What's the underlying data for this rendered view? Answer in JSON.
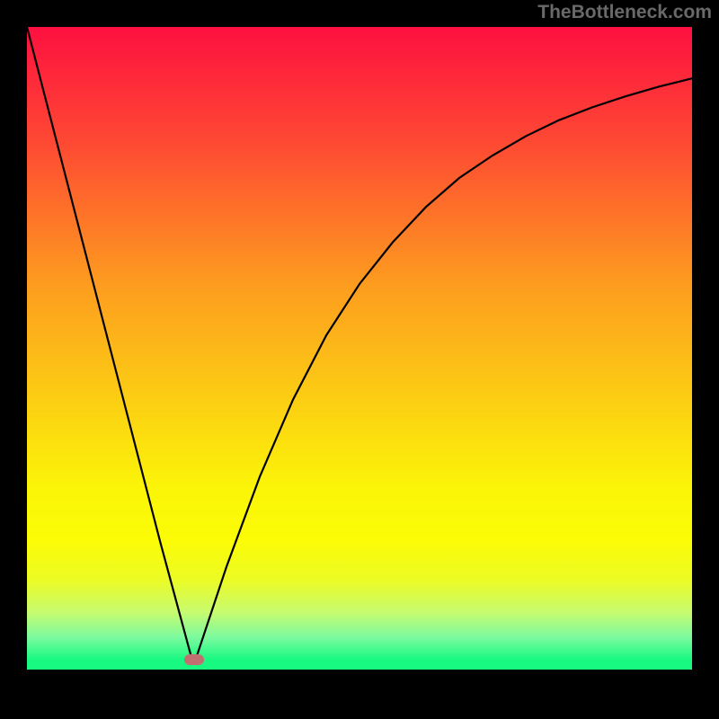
{
  "attribution": "TheBottleneck.com",
  "chart_data": {
    "type": "line",
    "title": "",
    "xlabel": "",
    "ylabel": "",
    "x_range": [
      0,
      1
    ],
    "y_range": [
      0,
      1
    ],
    "series": [
      {
        "name": "bottleneck-curve",
        "x": [
          0.0,
          0.05,
          0.1,
          0.15,
          0.2,
          0.247,
          0.255,
          0.3,
          0.35,
          0.4,
          0.45,
          0.5,
          0.55,
          0.6,
          0.65,
          0.7,
          0.75,
          0.8,
          0.85,
          0.9,
          0.95,
          1.0
        ],
        "y": [
          1.0,
          0.8,
          0.6,
          0.4,
          0.2,
          0.02,
          0.02,
          0.16,
          0.3,
          0.42,
          0.52,
          0.6,
          0.665,
          0.72,
          0.765,
          0.8,
          0.83,
          0.855,
          0.875,
          0.892,
          0.907,
          0.92
        ]
      }
    ],
    "optimal_point": {
      "x": 0.251,
      "y": 0.015
    },
    "gradient_stops": [
      {
        "pos": 0.0,
        "color": "#fd1040"
      },
      {
        "pos": 0.18,
        "color": "#fe4933"
      },
      {
        "pos": 0.4,
        "color": "#fd9c1f"
      },
      {
        "pos": 0.58,
        "color": "#fcce13"
      },
      {
        "pos": 0.72,
        "color": "#fbf508"
      },
      {
        "pos": 0.8,
        "color": "#fbfc06"
      },
      {
        "pos": 0.86,
        "color": "#ecfb25"
      },
      {
        "pos": 0.91,
        "color": "#c8fb6e"
      },
      {
        "pos": 0.95,
        "color": "#7bfa9f"
      },
      {
        "pos": 0.985,
        "color": "#17f981"
      },
      {
        "pos": 1.0,
        "color": "#17f981"
      }
    ]
  }
}
